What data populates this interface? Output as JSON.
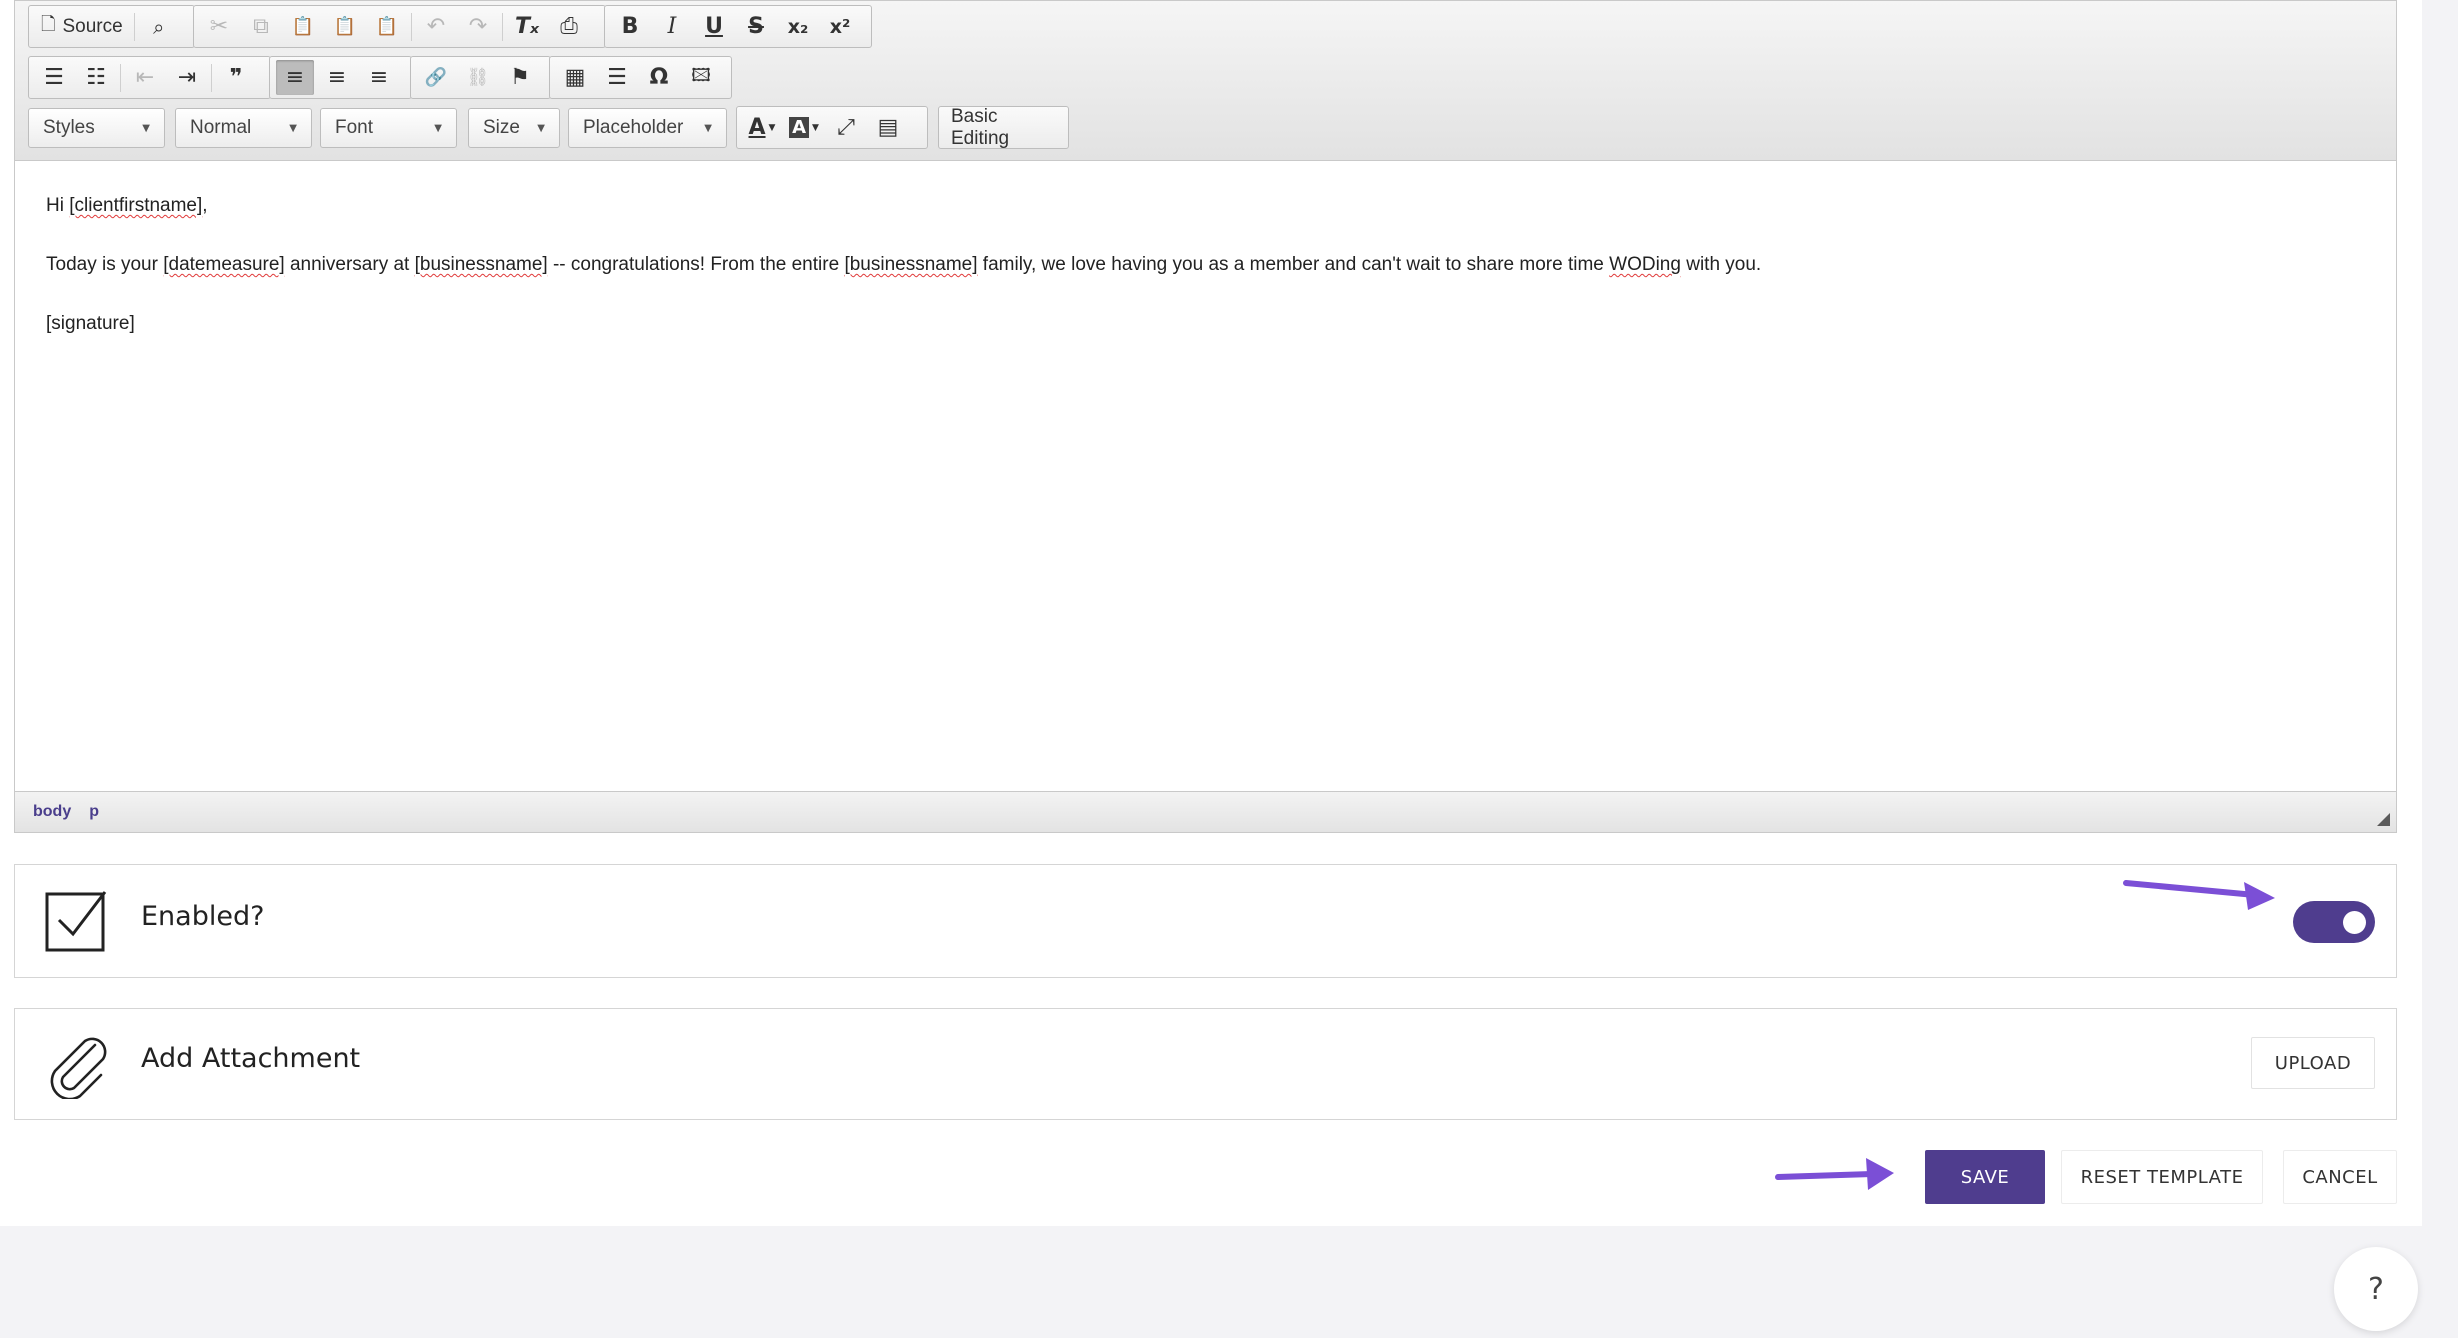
{
  "toolbar": {
    "row1": {
      "group1": [
        {
          "name": "source-button",
          "icon": "document-icon",
          "label": "Source"
        },
        {
          "name": "preview-button",
          "icon": "magnifier-document-icon",
          "label": ""
        }
      ],
      "group2": [
        {
          "name": "cut-button",
          "glyph": "✂",
          "disabled": true
        },
        {
          "name": "copy-button",
          "glyph": "⧉",
          "disabled": true
        },
        {
          "name": "paste-button",
          "glyph": "📋",
          "disabled": false
        },
        {
          "name": "paste-text-button",
          "glyph": "📋",
          "disabled": false
        },
        {
          "name": "paste-word-button",
          "glyph": "📋",
          "disabled": false
        },
        {
          "name": "undo-button",
          "glyph": "↶",
          "disabled": true
        },
        {
          "name": "redo-button",
          "glyph": "↷",
          "disabled": true
        },
        {
          "name": "remove-format-button",
          "glyph": "Tₓ",
          "disabled": false
        },
        {
          "name": "print-button",
          "glyph": "⎙",
          "disabled": false
        }
      ],
      "group3": [
        {
          "name": "bold-button",
          "glyph": "B"
        },
        {
          "name": "italic-button",
          "glyph": "I"
        },
        {
          "name": "underline-button",
          "glyph": "U"
        },
        {
          "name": "strike-button",
          "glyph": "S"
        },
        {
          "name": "subscript-button",
          "glyph": "x₂"
        },
        {
          "name": "superscript-button",
          "glyph": "x²"
        }
      ]
    },
    "row2": {
      "group1": [
        {
          "name": "numbered-list-button",
          "glyph": "☰"
        },
        {
          "name": "bulleted-list-button",
          "glyph": "☷"
        },
        {
          "name": "outdent-button",
          "glyph": "⇤",
          "disabled": true
        },
        {
          "name": "indent-button",
          "glyph": "⇥"
        },
        {
          "name": "blockquote-button",
          "glyph": "❞"
        }
      ],
      "group2": [
        {
          "name": "align-left-button",
          "glyph": "≡",
          "active": true
        },
        {
          "name": "align-center-button",
          "glyph": "≡"
        },
        {
          "name": "align-right-button",
          "glyph": "≡"
        }
      ],
      "group3": [
        {
          "name": "link-button",
          "glyph": "🔗"
        },
        {
          "name": "unlink-button",
          "glyph": "⛓",
          "disabled": true
        },
        {
          "name": "anchor-button",
          "glyph": "⚑"
        }
      ],
      "group4": [
        {
          "name": "table-button",
          "glyph": "▦"
        },
        {
          "name": "horizontal-line-button",
          "glyph": "☰"
        },
        {
          "name": "special-char-button",
          "glyph": "Ω"
        },
        {
          "name": "image-button",
          "glyph": "🖾"
        }
      ]
    },
    "row3": {
      "styles": "Styles",
      "format": "Normal",
      "font": "Font",
      "size": "Size",
      "placeholder": "Placeholder",
      "text_color_glyph": "A",
      "bg_color_glyph": "A",
      "maximize_glyph": "⤢",
      "show_blocks_glyph": "▤",
      "basic_editing": "Basic Editing"
    }
  },
  "content": {
    "line1_prefix": "Hi ",
    "line1_tag": "[clientfirstname]",
    "line1_suffix": ",",
    "line2_a": "Today is your ",
    "line2_tag1": "[datemeasure]",
    "line2_b": " anniversary at ",
    "line2_tag2": "[businessname]",
    "line2_c": " -- congratulations! From the entire ",
    "line2_tag3": "[businessname]",
    "line2_d": " family, we love having you as a member and can't wait to share more time ",
    "line2_tag4": "WODing",
    "line2_e": " with you.",
    "line3": "[signature]"
  },
  "statusbar": {
    "path1": "body",
    "path2": "p"
  },
  "enabled_panel": {
    "label": "Enabled?",
    "toggle_on": true
  },
  "attachment_panel": {
    "label": "Add Attachment",
    "upload_label": "UPLOAD"
  },
  "actions": {
    "save": "SAVE",
    "reset": "RESET TEMPLATE",
    "cancel": "CANCEL"
  },
  "help": {
    "label": "?"
  },
  "colors": {
    "accent": "#4f3d8e",
    "annotation_arrow": "#7b4fd6"
  }
}
